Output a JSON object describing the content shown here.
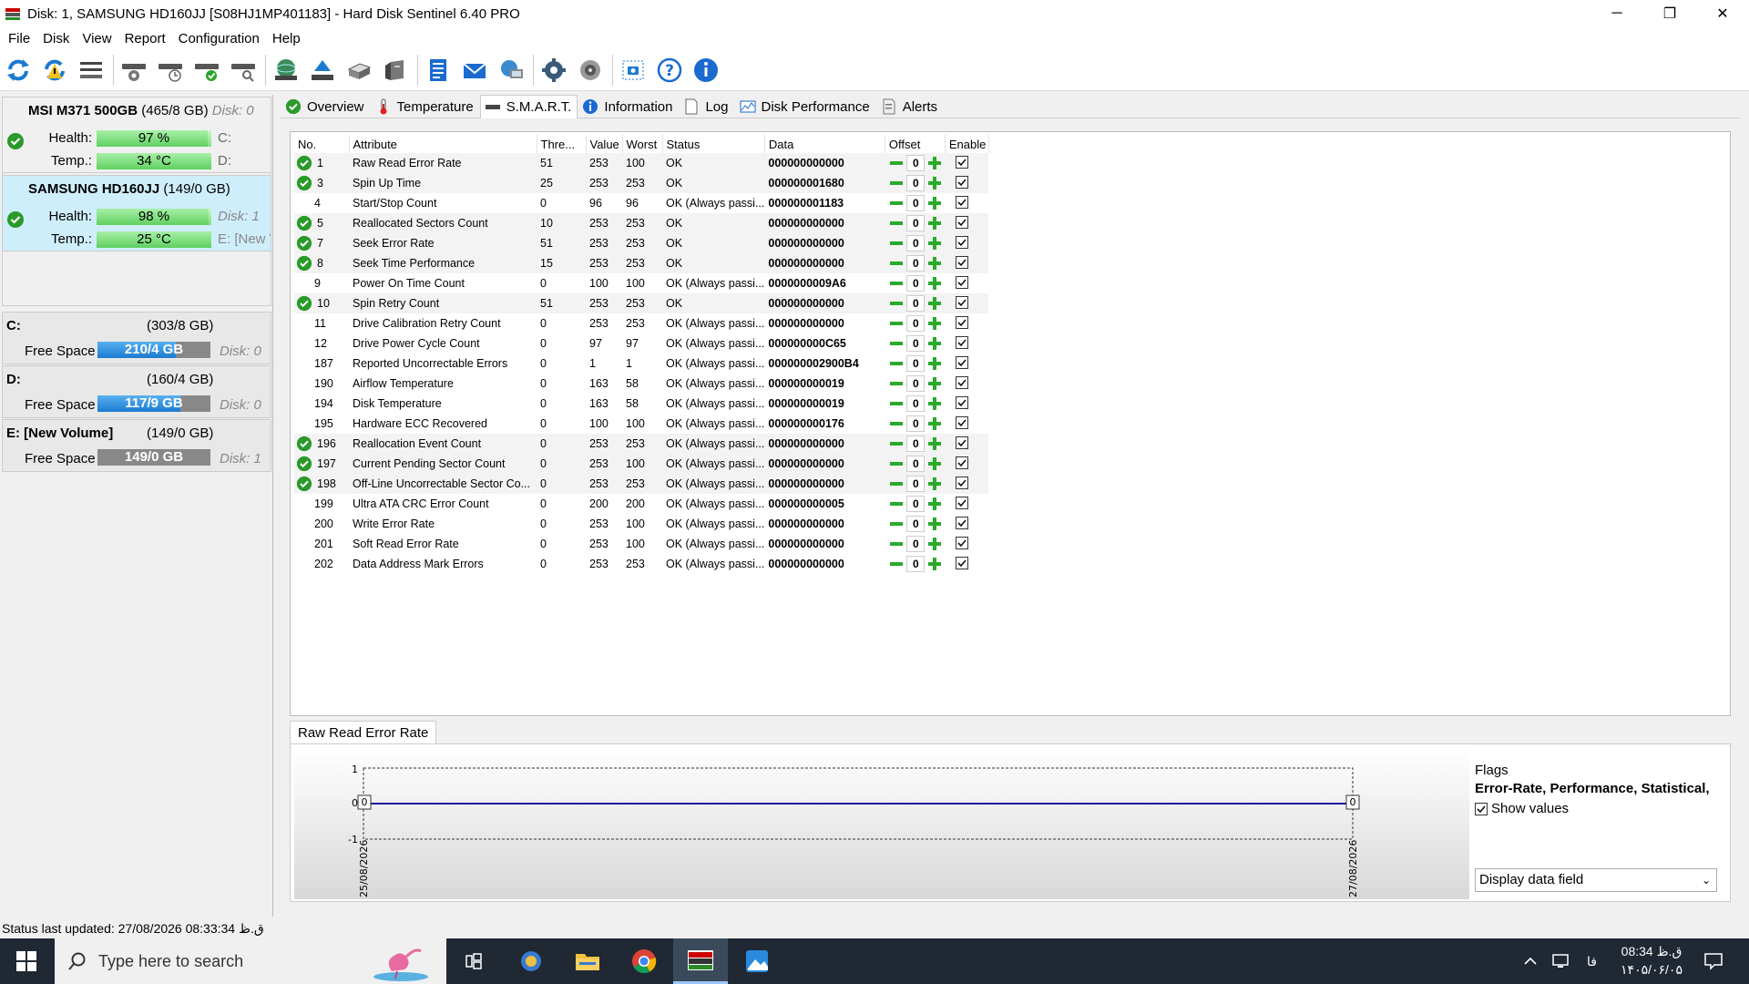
{
  "window": {
    "title": "Disk: 1, SAMSUNG HD160JJ [S08HJ1MP401183]  -  Hard Disk Sentinel 6.40 PRO",
    "min_glyph": "─",
    "max_glyph": "❐",
    "close_glyph": "✕"
  },
  "menu": [
    "File",
    "Disk",
    "View",
    "Report",
    "Configuration",
    "Help"
  ],
  "disks": [
    {
      "name": "MSI M371 500GB",
      "size": "(465/8 GB)",
      "index": "Disk: 0",
      "health_label": "Health:",
      "health": "97 %",
      "health_pct": 97,
      "temp_label": "Temp.:",
      "temp": "34 °C",
      "drive1": "C:",
      "drive2": "D:"
    },
    {
      "name": "SAMSUNG HD160JJ",
      "size": "(149/0 GB)",
      "index": "",
      "health_label": "Health:",
      "health": "98 %",
      "health_pct": 98,
      "temp_label": "Temp.:",
      "temp": "25 °C",
      "drive1": "Disk: 1",
      "drive2": "E: [New V"
    }
  ],
  "volumes": [
    {
      "name": "C:",
      "size": "(303/8 GB)",
      "free_label": "Free Space",
      "free": "210/4 GB",
      "free_pct": 69,
      "disk": "Disk: 0"
    },
    {
      "name": "D:",
      "size": "(160/4 GB)",
      "free_label": "Free Space",
      "free": "117/9 GB",
      "free_pct": 73,
      "disk": "Disk: 0"
    },
    {
      "name": "E: [New Volume]",
      "size": "(149/0 GB)",
      "free_label": "Free Space",
      "free": "149/0 GB",
      "free_pct": 0,
      "disk": "Disk: 1"
    }
  ],
  "tabs": [
    "Overview",
    "Temperature",
    "S.M.A.R.T.",
    "Information",
    "Log",
    "Disk Performance",
    "Alerts"
  ],
  "columns": [
    "No.",
    "Attribute",
    "Thre...",
    "Value",
    "Worst",
    "Status",
    "Data",
    "Offset",
    "Enable"
  ],
  "rows": [
    {
      "no": "1",
      "attr": "Raw Read Error Rate",
      "thr": "51",
      "val": "253",
      "worst": "100",
      "status": "OK",
      "data": "000000000000",
      "offset": "0",
      "ok": true
    },
    {
      "no": "3",
      "attr": "Spin Up Time",
      "thr": "25",
      "val": "253",
      "worst": "253",
      "status": "OK",
      "data": "000000001680",
      "offset": "0",
      "ok": true
    },
    {
      "no": "4",
      "attr": "Start/Stop Count",
      "thr": "0",
      "val": "96",
      "worst": "96",
      "status": "OK (Always passi...",
      "data": "000000001183",
      "offset": "0",
      "ok": false
    },
    {
      "no": "5",
      "attr": "Reallocated Sectors Count",
      "thr": "10",
      "val": "253",
      "worst": "253",
      "status": "OK",
      "data": "000000000000",
      "offset": "0",
      "ok": true
    },
    {
      "no": "7",
      "attr": "Seek Error Rate",
      "thr": "51",
      "val": "253",
      "worst": "253",
      "status": "OK",
      "data": "000000000000",
      "offset": "0",
      "ok": true
    },
    {
      "no": "8",
      "attr": "Seek Time Performance",
      "thr": "15",
      "val": "253",
      "worst": "253",
      "status": "OK",
      "data": "000000000000",
      "offset": "0",
      "ok": true
    },
    {
      "no": "9",
      "attr": "Power On Time Count",
      "thr": "0",
      "val": "100",
      "worst": "100",
      "status": "OK (Always passi...",
      "data": "0000000009A6",
      "offset": "0",
      "ok": false
    },
    {
      "no": "10",
      "attr": "Spin Retry Count",
      "thr": "51",
      "val": "253",
      "worst": "253",
      "status": "OK",
      "data": "000000000000",
      "offset": "0",
      "ok": true
    },
    {
      "no": "11",
      "attr": "Drive Calibration Retry Count",
      "thr": "0",
      "val": "253",
      "worst": "253",
      "status": "OK (Always passi...",
      "data": "000000000000",
      "offset": "0",
      "ok": false
    },
    {
      "no": "12",
      "attr": "Drive Power Cycle Count",
      "thr": "0",
      "val": "97",
      "worst": "97",
      "status": "OK (Always passi...",
      "data": "000000000C65",
      "offset": "0",
      "ok": false
    },
    {
      "no": "187",
      "attr": "Reported Uncorrectable Errors",
      "thr": "0",
      "val": "1",
      "worst": "1",
      "status": "OK (Always passi...",
      "data": "000000002900B4",
      "offset": "0",
      "ok": false
    },
    {
      "no": "190",
      "attr": "Airflow Temperature",
      "thr": "0",
      "val": "163",
      "worst": "58",
      "status": "OK (Always passi...",
      "data": "000000000019",
      "offset": "0",
      "ok": false
    },
    {
      "no": "194",
      "attr": "Disk Temperature",
      "thr": "0",
      "val": "163",
      "worst": "58",
      "status": "OK (Always passi...",
      "data": "000000000019",
      "offset": "0",
      "ok": false
    },
    {
      "no": "195",
      "attr": "Hardware ECC Recovered",
      "thr": "0",
      "val": "100",
      "worst": "100",
      "status": "OK (Always passi...",
      "data": "000000000176",
      "offset": "0",
      "ok": false
    },
    {
      "no": "196",
      "attr": "Reallocation Event Count",
      "thr": "0",
      "val": "253",
      "worst": "253",
      "status": "OK (Always passi...",
      "data": "000000000000",
      "offset": "0",
      "ok": true
    },
    {
      "no": "197",
      "attr": "Current Pending Sector Count",
      "thr": "0",
      "val": "253",
      "worst": "100",
      "status": "OK (Always passi...",
      "data": "000000000000",
      "offset": "0",
      "ok": true
    },
    {
      "no": "198",
      "attr": "Off-Line Uncorrectable Sector Co...",
      "thr": "0",
      "val": "253",
      "worst": "253",
      "status": "OK (Always passi...",
      "data": "000000000000",
      "offset": "0",
      "ok": true
    },
    {
      "no": "199",
      "attr": "Ultra ATA CRC Error Count",
      "thr": "0",
      "val": "200",
      "worst": "200",
      "status": "OK (Always passi...",
      "data": "000000000005",
      "offset": "0",
      "ok": false
    },
    {
      "no": "200",
      "attr": "Write Error Rate",
      "thr": "0",
      "val": "253",
      "worst": "100",
      "status": "OK (Always passi...",
      "data": "000000000000",
      "offset": "0",
      "ok": false
    },
    {
      "no": "201",
      "attr": "Soft Read Error Rate",
      "thr": "0",
      "val": "253",
      "worst": "100",
      "status": "OK (Always passi...",
      "data": "000000000000",
      "offset": "0",
      "ok": false
    },
    {
      "no": "202",
      "attr": "Data Address Mark Errors",
      "thr": "0",
      "val": "253",
      "worst": "253",
      "status": "OK (Always passi...",
      "data": "000000000000",
      "offset": "0",
      "ok": false
    }
  ],
  "graph": {
    "tab": "Raw Read Error Rate",
    "y_ticks": [
      "1",
      "0",
      "-1"
    ],
    "start_date": "25/08/2026",
    "end_date": "27/08/2026",
    "start_value": "0",
    "end_value": "0",
    "line_color": "#1a1aa0"
  },
  "flags": {
    "title": "Flags",
    "value": "Error-Rate, Performance, Statistical,",
    "show_values": "Show values",
    "dropdown": "Display data field"
  },
  "status": "Status last updated: 27/08/2026 08:33:34 ق.ظ",
  "taskbar": {
    "search_placeholder": "Type here to search",
    "lang": "فا",
    "time": "08:34 ق.ظ",
    "date": "۱۴۰۵/۰۶/۰۵"
  }
}
